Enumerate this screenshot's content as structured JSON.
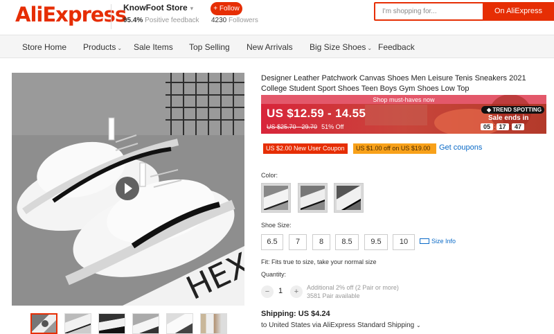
{
  "header": {
    "logo": "AliExpress",
    "store_name": "KnowFoot Store",
    "positive_feedback_value": "95.4%",
    "positive_feedback_label": "Positive feedback",
    "follow_label": "+ Follow",
    "followers_count": "4230",
    "followers_label": "Followers",
    "search_placeholder": "I'm shopping for...",
    "search_button": "On AliExpress"
  },
  "nav": {
    "items": [
      {
        "label": "Store Home"
      },
      {
        "label": "Products"
      },
      {
        "label": "Sale Items"
      },
      {
        "label": "Top Selling"
      },
      {
        "label": "New Arrivals"
      },
      {
        "label": "Big Size Shoes"
      },
      {
        "label": "Feedback"
      }
    ]
  },
  "product": {
    "title": "Designer Leather Patchwork Canvas Shoes Men Leisure Tenis Sneakers 2021 College Student Sport Shoes Teen Boys Gym Shoes Low Top",
    "banner_heading": "Shop must-haves now",
    "price_range": "US $12.59 - 14.55",
    "original_price": "US $25.70 - 29.70",
    "discount": "51% Off",
    "trend_badge": "TREND SPOTTING",
    "sale_ends_label": "Sale ends in",
    "timer": {
      "hours": "05",
      "minutes": "17",
      "seconds": "47"
    },
    "coupons": [
      {
        "label": "US $2.00 New User Coupon"
      },
      {
        "label": "US $1.00 off on US $19.00"
      }
    ],
    "get_coupons": "Get coupons",
    "color_label": "Color:",
    "size_label": "Shoe Size:",
    "sizes": [
      "6.5",
      "7",
      "8",
      "8.5",
      "9.5",
      "10"
    ],
    "size_info": "Size Info",
    "fit_note": "Fit: Fits true to size, take your normal size",
    "quantity_label": "Quantity:",
    "quantity_value": "1",
    "quantity_note_1": "Additional 2% off (2 Pair or more)",
    "quantity_note_2": "3581 Pair available",
    "shipping": "Shipping: US $4.24",
    "ship_to": "to United States via AliExpress Standard Shipping"
  },
  "colors": {
    "brand_red": "#e62e04",
    "coupon_orange": "#f8a11a",
    "link_blue": "#0a6ac7"
  }
}
